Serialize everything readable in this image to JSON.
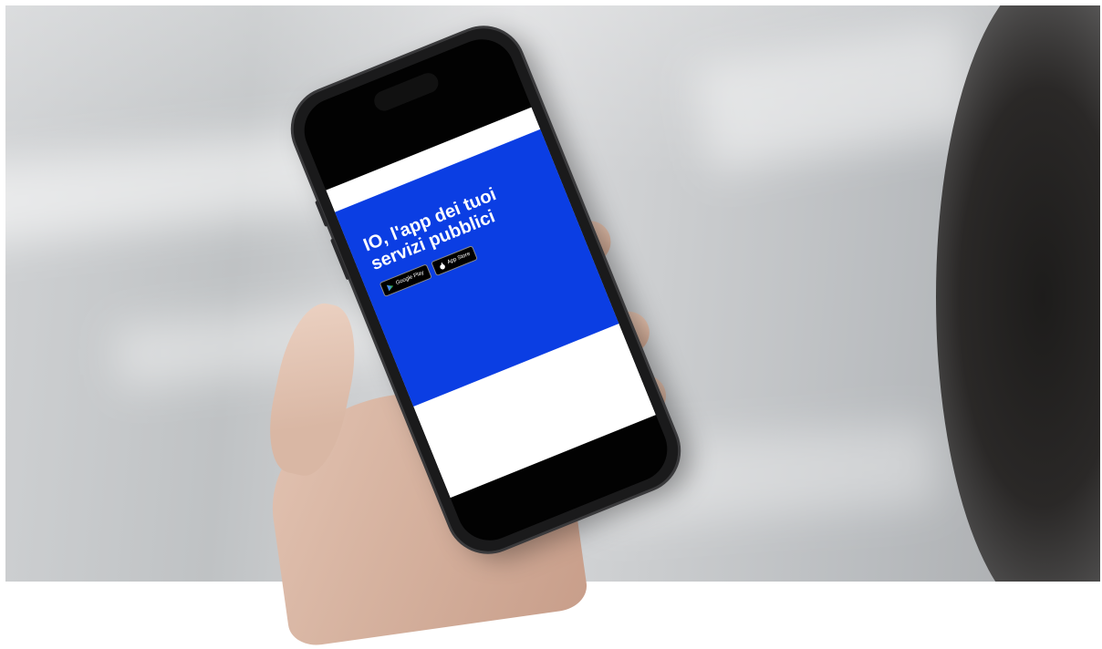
{
  "scene": {
    "description_colors": {
      "background": "#c7c9cb",
      "screen_blue": "#0b3ee3",
      "phone_body": "#1a1a1b"
    }
  },
  "website": {
    "title": "IO, l'app dei tuoi servizi pubblici",
    "body_text": "",
    "download_label": "",
    "badges": [
      {
        "icon": "google-play-icon",
        "text": "Google Play"
      },
      {
        "icon": "apple-icon",
        "text": "App Store"
      }
    ]
  }
}
